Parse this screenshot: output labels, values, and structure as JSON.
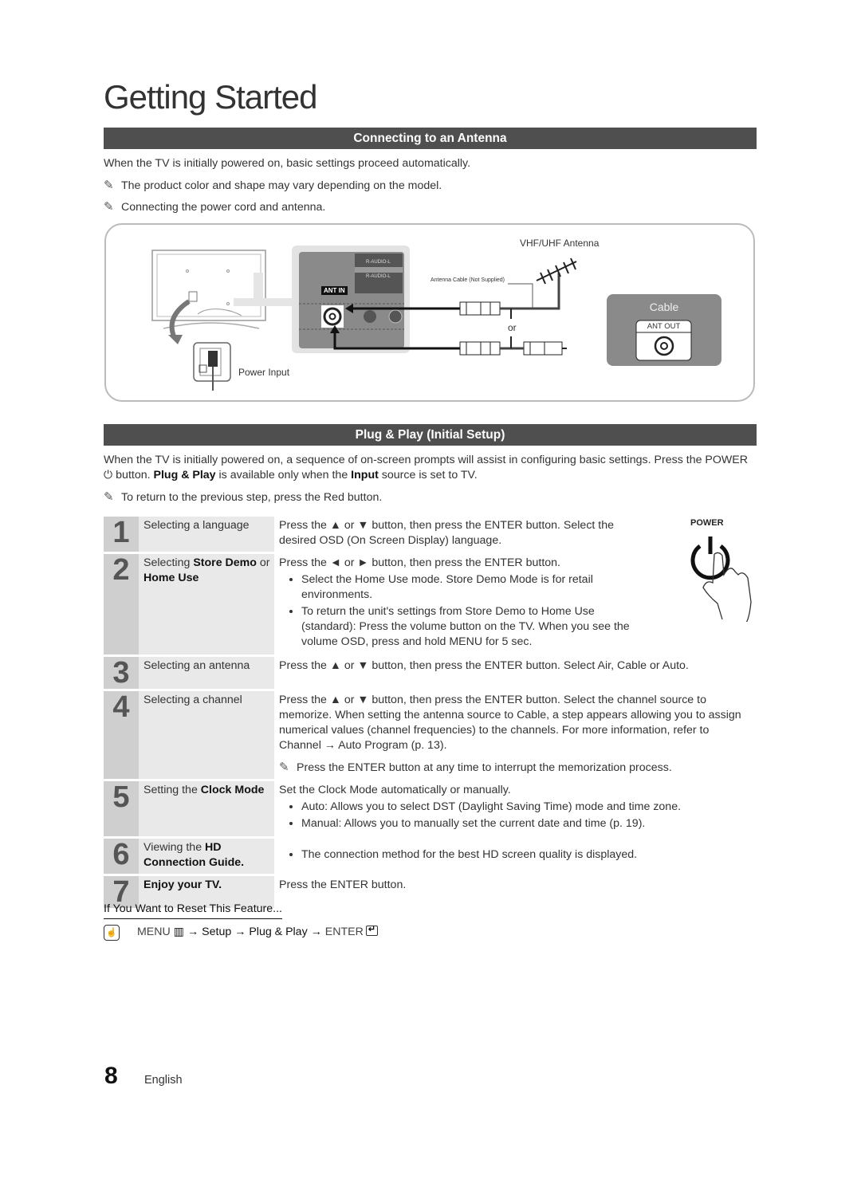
{
  "page": {
    "title": "Getting Started",
    "page_number": "8",
    "language": "English"
  },
  "antenna_section": {
    "header": "Connecting to an Antenna",
    "intro": "When the TV is initially powered on, basic settings proceed automatically.",
    "notes": [
      "The product color and shape may vary depending on the model.",
      "Connecting the power cord and antenna."
    ],
    "diagram": {
      "ant_in_label": "ANT IN",
      "audio_label_1": "R-AUDIO-L",
      "audio_label_2": "R-AUDIO-L",
      "antenna_label": "VHF/UHF Antenna",
      "cable_label": "Antenna Cable (Not Supplied)",
      "or_label": "or",
      "power_input_label": "Power Input",
      "cable_box_title": "Cable",
      "ant_out_label": "ANT OUT"
    }
  },
  "plug_play": {
    "header": "Plug & Play (Initial Setup)",
    "intro_1": "When the TV is initially powered on, a sequence of on-screen prompts will assist in configuring basic settings. Press the",
    "intro_power": "POWER",
    "intro_2": "button.",
    "intro_pp": "Plug & Play",
    "intro_3": "is available only when the",
    "intro_input": "Input",
    "intro_4": "source is set to TV.",
    "note": "To return to the previous step, press the Red button.",
    "power_illustration_label": "POWER",
    "steps": [
      {
        "num": "1",
        "label": "Selecting a language",
        "desc": "Press the ▲ or ▼ button, then press the ENTER button. Select the desired OSD (On Screen Display) language."
      },
      {
        "num": "2",
        "label_pre": "Selecting",
        "label_b1": "Store Demo",
        "label_mid": "or",
        "label_b2": "Home Use",
        "desc": "Press the ◄ or ► button, then press the ENTER button.",
        "bullets": [
          "Select the Home Use mode. Store Demo Mode is for retail environments.",
          "To return the unit's settings from Store Demo to Home Use (standard): Press the volume button on the TV. When you see the volume OSD, press and hold MENU for 5 sec."
        ]
      },
      {
        "num": "3",
        "label": "Selecting an antenna",
        "desc": "Press the ▲ or ▼ button, then press the ENTER button. Select Air, Cable or Auto."
      },
      {
        "num": "4",
        "label": "Selecting a channel",
        "desc": "Press the ▲ or ▼ button, then press the ENTER button. Select the channel source to memorize. When setting the antenna source to Cable, a step appears allowing you to assign numerical values (channel frequencies) to the channels. For more information, refer to Channel → Auto Program (p. 13).",
        "note": "Press the ENTER button at any time to interrupt the memorization process."
      },
      {
        "num": "5",
        "label_pre": "Setting the",
        "label_b1": "Clock Mode",
        "desc": "Set the Clock Mode automatically or manually.",
        "bullets": [
          "Auto: Allows you to select DST (Daylight Saving Time) mode and time zone.",
          "Manual: Allows you to manually set the current date and time (p. 19)."
        ]
      },
      {
        "num": "6",
        "label_pre": "Viewing the",
        "label_b1": "HD Connection Guide.",
        "bullets": [
          "The connection method for the best HD screen quality is displayed."
        ]
      },
      {
        "num": "7",
        "label_b1": "Enjoy your TV.",
        "desc": "Press the ENTER button."
      }
    ]
  },
  "reset": {
    "heading": "If You Want to Reset This Feature...",
    "path": [
      "MENU",
      "Setup",
      "Plug & Play",
      "ENTER"
    ]
  }
}
